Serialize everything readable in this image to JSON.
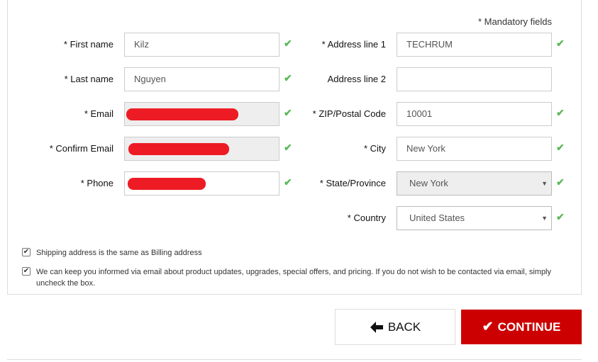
{
  "mandatory_note": "* Mandatory fields",
  "left_fields": [
    {
      "label": "* First name",
      "value": "Kilz",
      "readonly": false,
      "redacted": false
    },
    {
      "label": "* Last name",
      "value": "Nguyen",
      "readonly": false,
      "redacted": false
    },
    {
      "label": "* Email",
      "value": "",
      "readonly": true,
      "redacted": true
    },
    {
      "label": "* Confirm Email",
      "value": "",
      "readonly": true,
      "redacted": true
    },
    {
      "label": "* Phone",
      "value": "",
      "readonly": false,
      "redacted": true
    }
  ],
  "right_fields": [
    {
      "label": "* Address line 1",
      "value": "TECHRUM",
      "valid": true
    },
    {
      "label": "Address line 2",
      "value": "",
      "valid": false
    },
    {
      "label": "* ZIP/Postal Code",
      "value": "10001",
      "valid": true
    },
    {
      "label": "* City",
      "value": "New York",
      "valid": true
    },
    {
      "label": "* State/Province",
      "value": "New York",
      "valid": true,
      "type": "select",
      "disabled": true
    },
    {
      "label": "* Country",
      "value": "United States",
      "valid": true,
      "type": "select"
    }
  ],
  "checkboxes": [
    {
      "label": "Shipping address is the same as Billing address",
      "checked": true
    },
    {
      "label": "We can keep you informed via email about product updates, upgrades, special offers, and pricing. If you do not wish to be contacted via email, simply uncheck the box.",
      "checked": true
    }
  ],
  "buttons": {
    "back": "BACK",
    "continue": "CONTINUE"
  },
  "colors": {
    "accent": "#cc0000",
    "valid": "#5cb85c",
    "redaction": "#ed1c24"
  },
  "icons": {
    "valid": "check-icon",
    "back": "arrow-left-icon",
    "continue": "check-icon"
  }
}
